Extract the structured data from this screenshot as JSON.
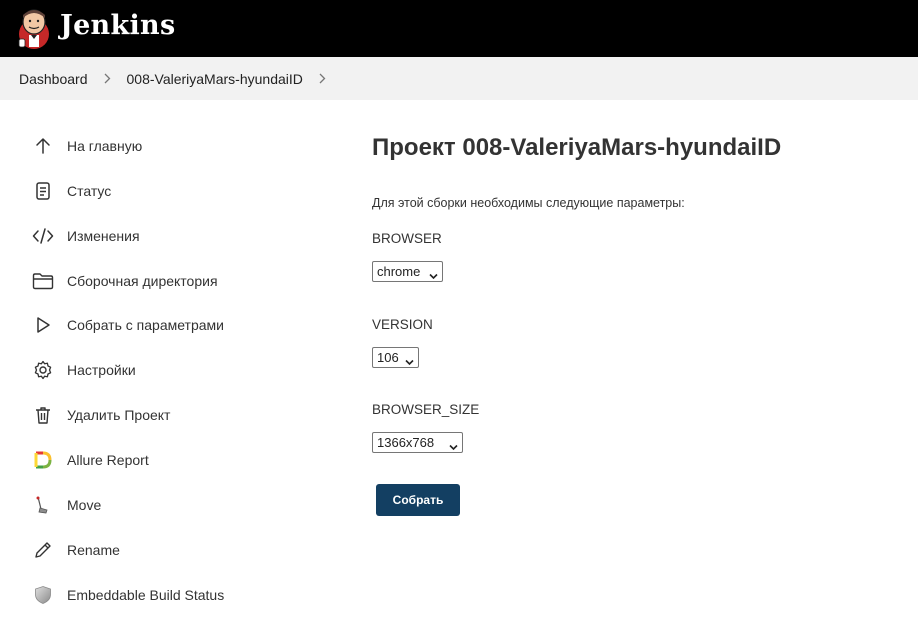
{
  "header": {
    "brand": "Jenkins"
  },
  "breadcrumb": {
    "items": [
      "Dashboard",
      "008-ValeriyaMars-hyundaiID"
    ]
  },
  "sidebar": {
    "items": [
      {
        "label": "На главную",
        "icon": "arrow-up-icon"
      },
      {
        "label": "Статус",
        "icon": "document-icon"
      },
      {
        "label": "Изменения",
        "icon": "code-icon"
      },
      {
        "label": "Сборочная директория",
        "icon": "folder-icon"
      },
      {
        "label": "Собрать с параметрами",
        "icon": "play-icon"
      },
      {
        "label": "Настройки",
        "icon": "gear-icon"
      },
      {
        "label": "Удалить Проект",
        "icon": "trash-icon"
      },
      {
        "label": "Allure Report",
        "icon": "allure-icon"
      },
      {
        "label": "Move",
        "icon": "move-icon"
      },
      {
        "label": "Rename",
        "icon": "pencil-icon"
      },
      {
        "label": "Embeddable Build Status",
        "icon": "shield-icon"
      }
    ]
  },
  "main": {
    "title": "Проект 008-ValeriyaMars-hyundaiID",
    "description": "Для этой сборки необходимы следующие параметры:",
    "params": [
      {
        "name": "BROWSER",
        "value": "chrome"
      },
      {
        "name": "VERSION",
        "value": "106"
      },
      {
        "name": "BROWSER_SIZE",
        "value": "1366x768"
      }
    ],
    "build_button": "Собрать"
  },
  "colors": {
    "header_bg": "#000000",
    "breadcrumb_bg": "#f2f2f2",
    "button_bg": "#133f62"
  }
}
